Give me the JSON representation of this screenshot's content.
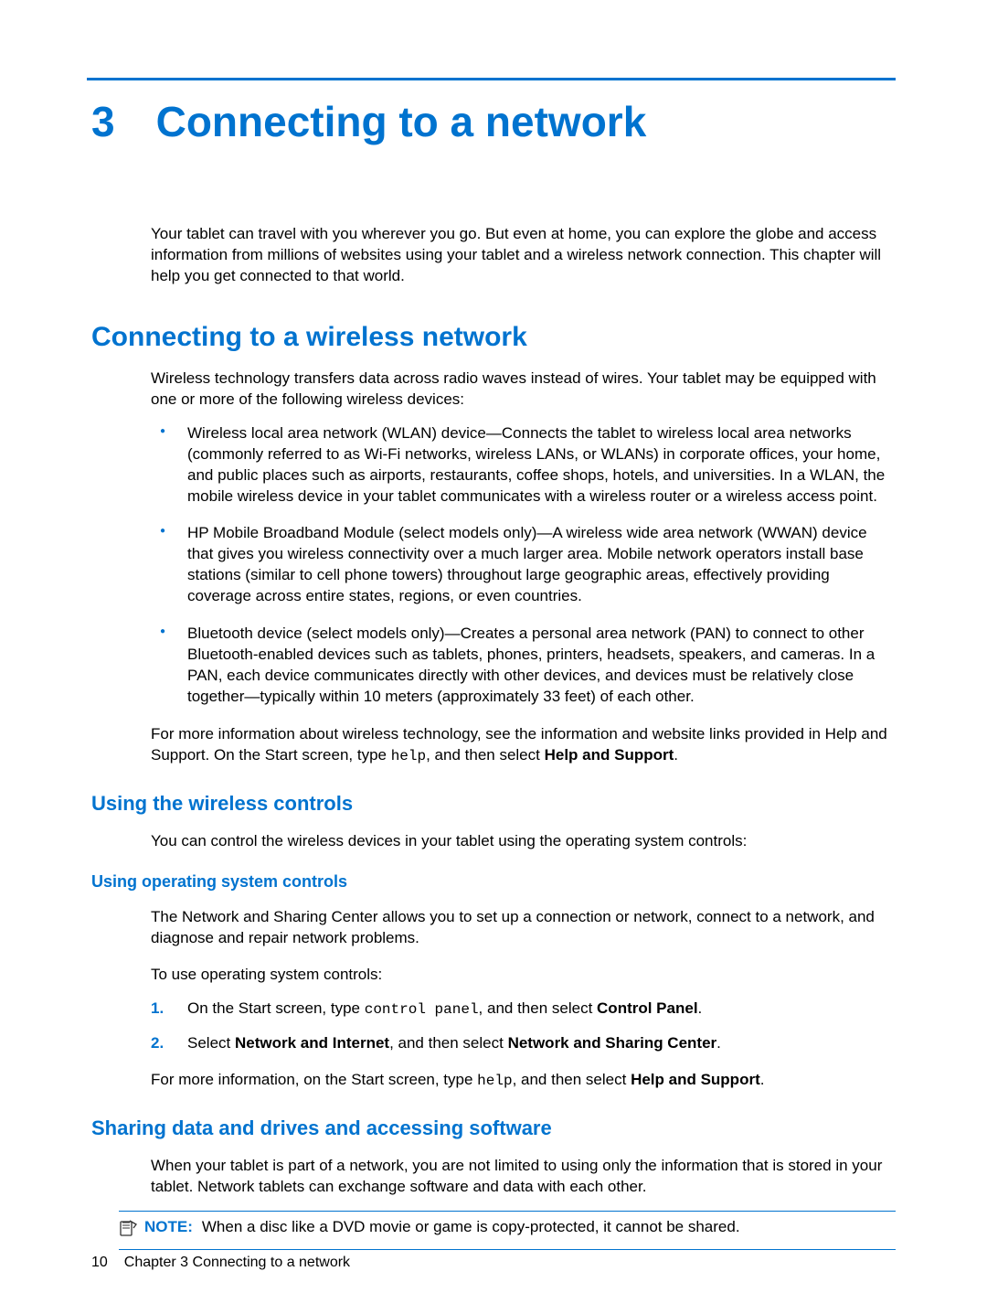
{
  "chapter": {
    "number": "3",
    "title": "Connecting to a network"
  },
  "intro": "Your tablet can travel with you wherever you go. But even at home, you can explore the globe and access information from millions of websites using your tablet and a wireless network connection. This chapter will help you get connected to that world.",
  "section1": {
    "heading": "Connecting to a wireless network",
    "p1": "Wireless technology transfers data across radio waves instead of wires. Your tablet may be equipped with one or more of the following wireless devices:",
    "bullets": {
      "b1": "Wireless local area network (WLAN) device—Connects the tablet to wireless local area networks (commonly referred to as Wi-Fi networks, wireless LANs, or WLANs) in corporate offices, your home, and public places such as airports, restaurants, coffee shops, hotels, and universities. In a WLAN, the mobile wireless device in your tablet communicates with a wireless router or a wireless access point.",
      "b2": "HP Mobile Broadband Module (select models only)—A wireless wide area network (WWAN) device that gives you wireless connectivity over a much larger area. Mobile network operators install base stations (similar to cell phone towers) throughout large geographic areas, effectively providing coverage across entire states, regions, or even countries.",
      "b3": "Bluetooth device (select models only)—Creates a personal area network (PAN) to connect to other Bluetooth-enabled devices such as tablets, phones, printers, headsets, speakers, and cameras. In a PAN, each device communicates directly with other devices, and devices must be relatively close together—typically within 10 meters (approximately 33 feet) of each other."
    },
    "p2a": "For more information about wireless technology, see the information and website links provided in Help and Support. On the Start screen, type ",
    "p2code": "help",
    "p2b": ", and then select ",
    "p2bold": "Help and Support",
    "p2c": "."
  },
  "sub1": {
    "heading": "Using the wireless controls",
    "p1": "You can control the wireless devices in your tablet using the operating system controls:"
  },
  "sub2": {
    "heading": "Using operating system controls",
    "p1": "The Network and Sharing Center allows you to set up a connection or network, connect to a network, and diagnose and repair network problems.",
    "p2": "To use operating system controls:",
    "step1a": "On the Start screen, type ",
    "step1code": "control panel",
    "step1b": ", and then select ",
    "step1bold": "Control Panel",
    "step1c": ".",
    "step2a": "Select ",
    "step2bold1": "Network and Internet",
    "step2b": ", and then select ",
    "step2bold2": "Network and Sharing Center",
    "step2c": ".",
    "p3a": "For more information, on the Start screen, type ",
    "p3code": "help",
    "p3b": ", and then select ",
    "p3bold": "Help and Support",
    "p3c": "."
  },
  "sub3": {
    "heading": "Sharing data and drives and accessing software",
    "p1": "When your tablet is part of a network, you are not limited to using only the information that is stored in your tablet. Network tablets can exchange software and data with each other.",
    "note_label": "NOTE:",
    "note_text": "When a disc like a DVD movie or game is copy-protected, it cannot be shared."
  },
  "footer": {
    "pagenum": "10",
    "chapref": "Chapter 3   Connecting to a network"
  }
}
